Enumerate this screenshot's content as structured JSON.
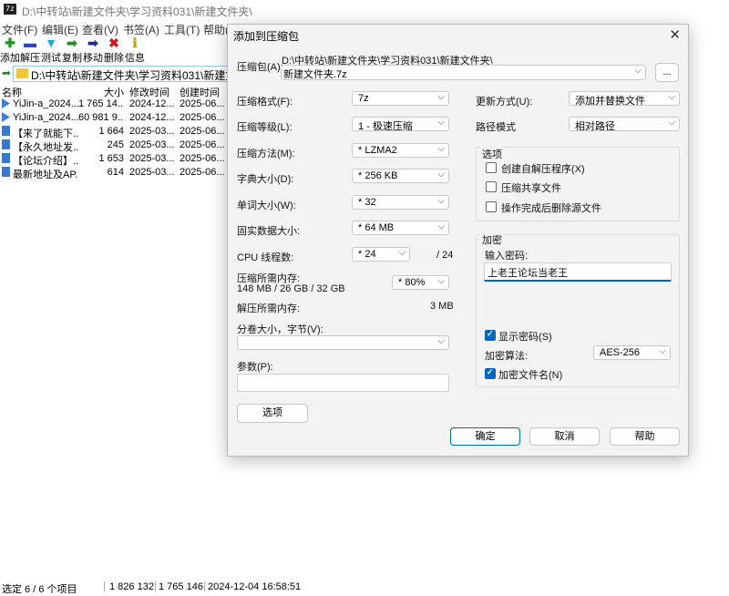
{
  "window": {
    "icon_text": "7z",
    "title": "D:\\中转站\\新建文件夹\\学习资料031\\新建文件夹\\"
  },
  "menu": [
    "文件(F)",
    "编辑(E)",
    "查看(V)",
    "书签(A)",
    "工具(T)",
    "帮助(H"
  ],
  "toolbar": [
    {
      "label": "添加",
      "icon": "plus-icon",
      "symbol": "✚",
      "color": "#1a9a1a"
    },
    {
      "label": "解压",
      "icon": "minus-icon",
      "symbol": "▬",
      "color": "#2a45c7"
    },
    {
      "label": "测试",
      "icon": "check-arrow-icon",
      "symbol": "▼",
      "color": "#29a5d6"
    },
    {
      "label": "复制",
      "icon": "copy-arrow-icon",
      "symbol": "➡",
      "color": "#2a8a2a"
    },
    {
      "label": "移动",
      "icon": "move-arrow-icon",
      "symbol": "➡",
      "color": "#1d2a8a"
    },
    {
      "label": "删除",
      "icon": "delete-x-icon",
      "symbol": "✖",
      "color": "#d11919"
    },
    {
      "label": "信息",
      "icon": "info-icon",
      "symbol": "ℹ",
      "color": "#c7a000"
    }
  ],
  "path": "D:\\中转站\\新建文件夹\\学习资料031\\新建文件夹\\",
  "columns": {
    "name": "名称",
    "size": "大小",
    "modified": "修改时间",
    "created": "创建时间"
  },
  "files": [
    {
      "name": "YiJin-a_2024...",
      "size": "1 765 14...",
      "modified": "2024-12...",
      "created": "2025-06...",
      "type": "video"
    },
    {
      "name": "YiJin-a_2024...",
      "size": "60 981 9...",
      "modified": "2024-12...",
      "created": "2025-06...",
      "type": "video"
    },
    {
      "name": "【来了就能下...",
      "size": "1 664",
      "modified": "2025-03...",
      "created": "2025-06...",
      "type": "doc"
    },
    {
      "name": "【永久地址发...",
      "size": "245",
      "modified": "2025-03...",
      "created": "2025-06...",
      "type": "doc"
    },
    {
      "name": "【论坛介绍】...",
      "size": "1 653",
      "modified": "2025-03...",
      "created": "2025-06...",
      "type": "doc"
    },
    {
      "name": "最新地址及AP...",
      "size": "614",
      "modified": "2025-03...",
      "created": "2025-06...",
      "type": "doc"
    }
  ],
  "status": {
    "selection": "选定 6 / 6 个项目",
    "total": "1 826 132",
    "selected_size": "1 765 146",
    "datetime": "2024-12-04 16:58:51"
  },
  "dialog": {
    "title": "添加到压缩包",
    "archive_label": "压缩包(A):",
    "archive_dir": "D:\\中转站\\新建文件夹\\学习资料031\\新建文件夹\\",
    "archive_name": "新建文件夹.7z",
    "browse_label": "...",
    "format_label": "压缩格式(F):",
    "format_value": "7z",
    "level_label": "压缩等级(L):",
    "level_value": "1 - 极速压缩",
    "method_label": "压缩方法(M):",
    "method_value": "* LZMA2",
    "dict_label": "字典大小(D):",
    "dict_value": "* 256 KB",
    "word_label": "单词大小(W):",
    "word_value": "* 32",
    "solid_label": "固实数据大小:",
    "solid_value": "* 64 MB",
    "threads_label": "CPU 线程数:",
    "threads_value": "* 24",
    "threads_max": "/ 24",
    "mem_comp_label": "压缩所需内存:",
    "mem_comp_value": "148 MB / 26 GB / 32 GB",
    "mem_percent": "* 80%",
    "mem_decomp_label": "解压所需内存:",
    "mem_decomp_value": "3 MB",
    "volume_label": "分卷大小，字节(V):",
    "volume_value": "",
    "params_label": "参数(P):",
    "params_value": "",
    "options_button": "选项",
    "update_label": "更新方式(U):",
    "update_value": "添加并替换文件",
    "pathmode_label": "路径模式",
    "pathmode_value": "相对路径",
    "options_group": "选项",
    "opt_sfx": "创建自解压程序(X)",
    "opt_shared": "压缩共享文件",
    "opt_delete": "操作完成后删除源文件",
    "encrypt_group": "加密",
    "password_label": "输入密码:",
    "password_value": "上老王论坛当老王",
    "show_password": "显示密码(S)",
    "enc_method_label": "加密算法:",
    "enc_method_value": "AES-256",
    "encrypt_names": "加密文件名(N)",
    "ok": "确定",
    "cancel": "取消",
    "help": "帮助"
  }
}
